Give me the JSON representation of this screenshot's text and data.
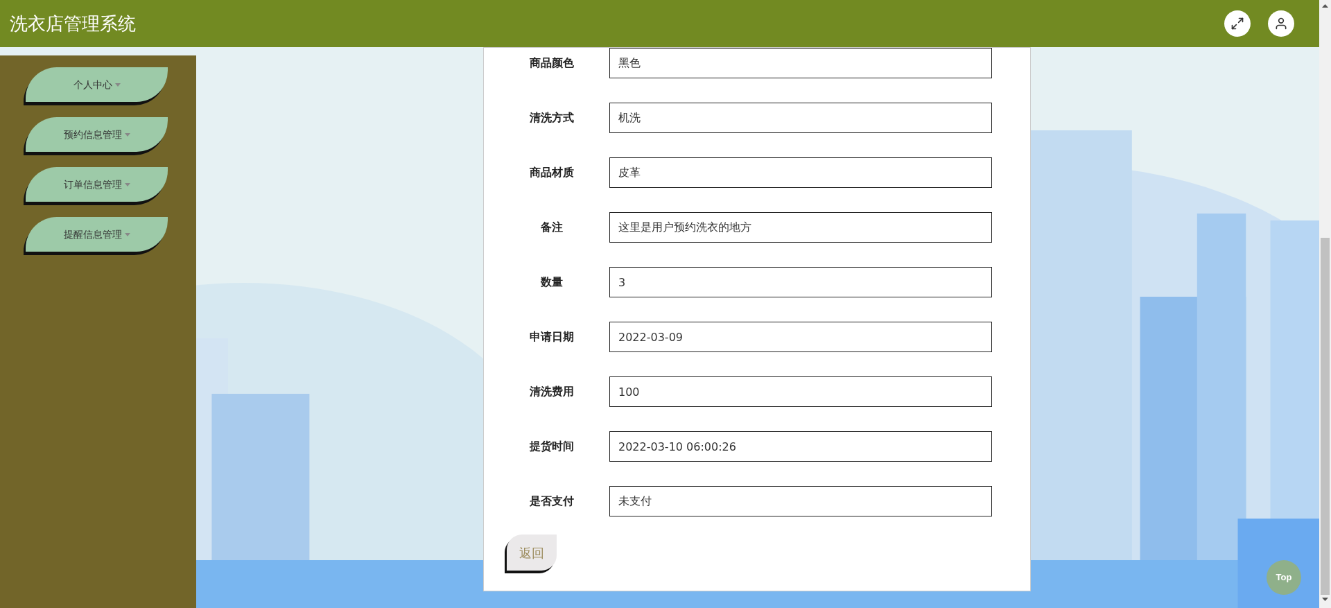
{
  "header": {
    "title": "洗衣店管理系统"
  },
  "sidebar": {
    "items": [
      {
        "label": "个人中心"
      },
      {
        "label": "预约信息管理"
      },
      {
        "label": "订单信息管理"
      },
      {
        "label": "提醒信息管理"
      }
    ]
  },
  "form": {
    "fields": [
      {
        "label": "商品颜色",
        "value": "黑色"
      },
      {
        "label": "清洗方式",
        "value": "机洗"
      },
      {
        "label": "商品材质",
        "value": "皮革"
      },
      {
        "label": "备注",
        "value": "这里是用户预约洗衣的地方"
      },
      {
        "label": "数量",
        "value": "3"
      },
      {
        "label": "申请日期",
        "value": "2022-03-09"
      },
      {
        "label": "清洗费用",
        "value": "100"
      },
      {
        "label": "提货时间",
        "value": "2022-03-10 06:00:26"
      },
      {
        "label": "是否支付",
        "value": "未支付"
      }
    ],
    "back_button": "返回"
  },
  "top_button": "Top"
}
